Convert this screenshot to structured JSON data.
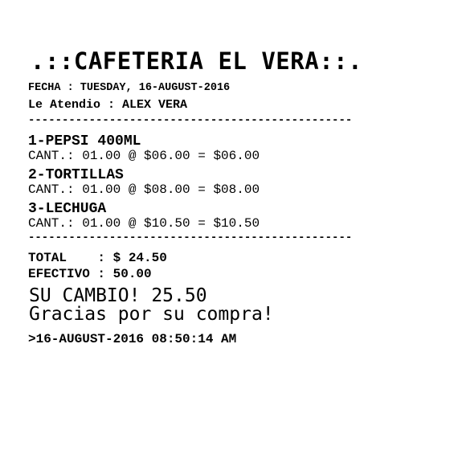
{
  "receipt": {
    "title": ".::CAFETERIA EL VERA::.",
    "fecha": "FECHA : TUESDAY, 16-AUGUST-2016",
    "atendio": "Le Atendio : ALEX VERA",
    "separator": "------------------------------------------------",
    "items": [
      {
        "name": "1-PEPSI 400ML",
        "detail": "CANT.: 01.00 @ $06.00 = $06.00"
      },
      {
        "name": "2-TORTILLAS",
        "detail": "CANT.: 01.00 @ $08.00 = $08.00"
      },
      {
        "name": "3-LECHUGA",
        "detail": "CANT.: 01.00 @ $10.50 = $10.50"
      }
    ],
    "total": "TOTAL    : $ 24.50",
    "efectivo": "EFECTIVO : 50.00",
    "cambio": "SU CAMBIO! 25.50",
    "gracias": "Gracias por su compra!",
    "timestamp": ">16-AUGUST-2016 08:50:14 AM"
  }
}
